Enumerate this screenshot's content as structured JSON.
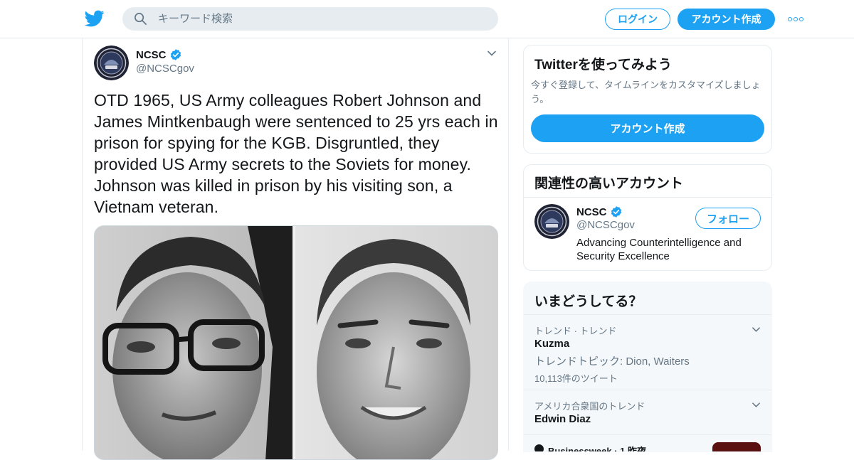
{
  "header": {
    "search_placeholder": "キーワード検索",
    "login_label": "ログイン",
    "signup_label": "アカウント作成"
  },
  "tweet": {
    "author_name": "NCSC",
    "author_handle": "@NCSCgov",
    "text": "OTD 1965, US Army colleagues Robert Johnson and James Mintkenbaugh were sentenced to 25 yrs each in prison for spying for the KGB. Disgruntled, they provided US Army secrets to the Soviets for money. Johnson was killed in prison by his visiting son, a Vietnam veteran."
  },
  "sidebar": {
    "signup_card": {
      "title": "Twitterを使ってみよう",
      "description": "今すぐ登録して、タイムラインをカスタマイズしましょう。",
      "button_label": "アカウント作成"
    },
    "related_card": {
      "title": "関連性の高いアカウント",
      "account_name": "NCSC",
      "account_handle": "@NCSCgov",
      "follow_label": "フォロー",
      "bio": "Advancing Counterintelligence and Security Excellence"
    },
    "trends_card": {
      "title": "いまどうしてる？",
      "trends": [
        {
          "meta": "トレンド · トレンド",
          "name": "Kuzma",
          "topic": "トレンドトピック: Dion, Waiters",
          "count": "10,113件のツイート"
        },
        {
          "meta": "アメリカ合衆国のトレンド",
          "name": "Edwin Diaz"
        },
        {
          "meta": "Businessweek · 1 昨夜"
        }
      ]
    }
  },
  "colors": {
    "brand_blue": "#1da1f2",
    "secondary_text": "#657786",
    "border": "#e6ecf0"
  }
}
